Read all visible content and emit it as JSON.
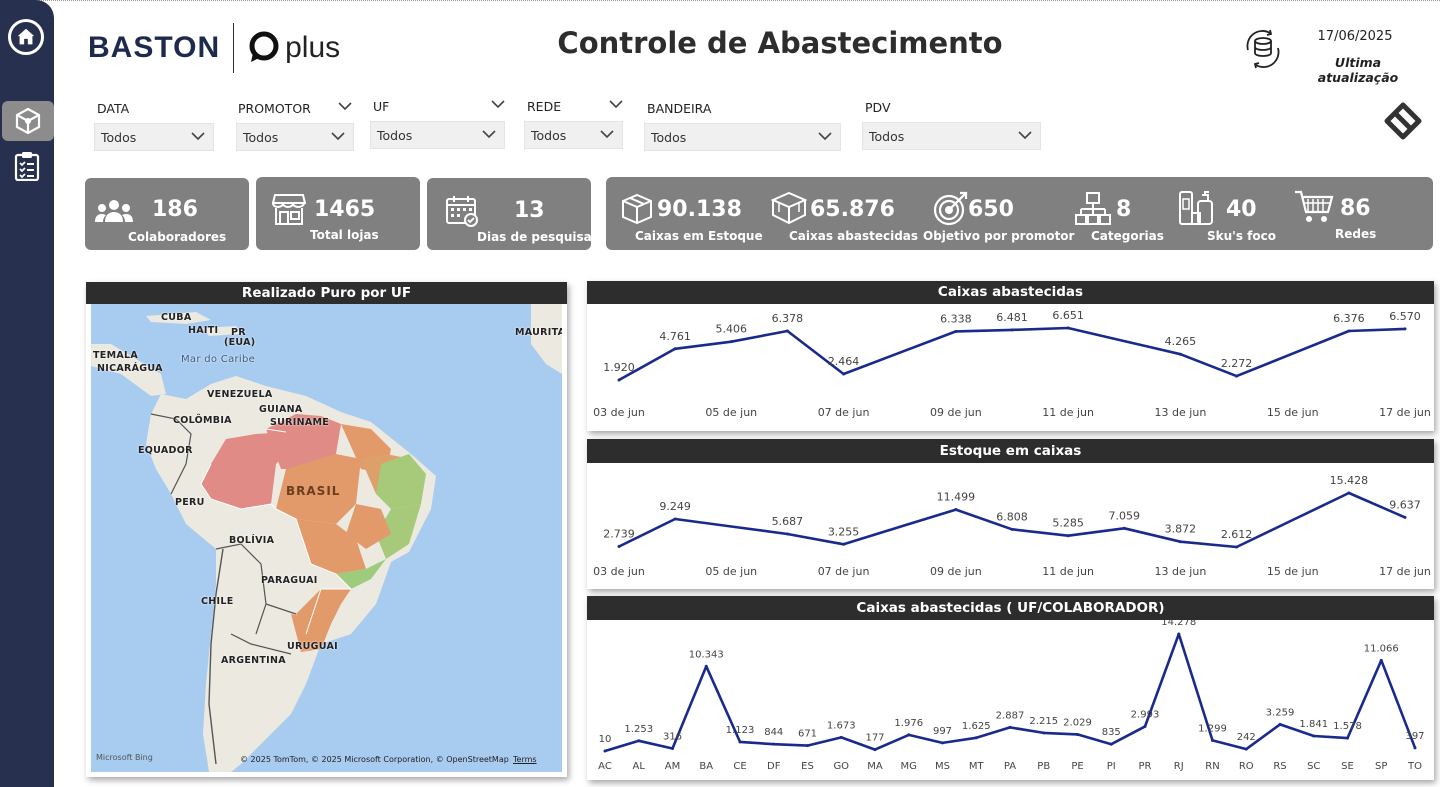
{
  "header": {
    "title": "Controle de Abastecimento",
    "logo_brand": "BASTON",
    "logo_plus": "plus",
    "update_date": "17/06/2025",
    "update_label": "Ultima atualização"
  },
  "filters": [
    {
      "label": "DATA",
      "value": "Todos"
    },
    {
      "label": "PROMOTOR",
      "value": "Todos"
    },
    {
      "label": "UF",
      "value": "Todos"
    },
    {
      "label": "REDE",
      "value": "Todos"
    },
    {
      "label": "BANDEIRA",
      "value": "Todos"
    },
    {
      "label": "PDV",
      "value": "Todos"
    }
  ],
  "kpis": [
    {
      "value": "186",
      "label": "Colaboradores",
      "icon": "people-icon"
    },
    {
      "value": "1465",
      "label": "Total lojas",
      "icon": "store-icon"
    },
    {
      "value": "13",
      "label": "Dias de pesquisa",
      "icon": "calendar-icon"
    },
    {
      "value": "90.138",
      "label": "Caixas em Estoque",
      "icon": "box-icon"
    },
    {
      "value": "65.876",
      "label": "Caixas abastecidas",
      "icon": "boxes-icon"
    },
    {
      "value": "650",
      "label": "Objetivo por promotor",
      "icon": "target-icon"
    },
    {
      "value": "8",
      "label": "Categorias",
      "icon": "hierarchy-icon"
    },
    {
      "value": "40",
      "label": "Sku's foco",
      "icon": "products-icon"
    },
    {
      "value": "86",
      "label": "Redes",
      "icon": "cart-icon"
    }
  ],
  "map": {
    "title": "Realizado Puro por UF",
    "labels": {
      "cuba": "CUBA",
      "haiti": "HAITI",
      "pr": "PR",
      "eua": "(EUA)",
      "mauritania": "MAURITA",
      "caribe": "Mar do Caribe",
      "guatemala": "TEMALA",
      "nicaragua": "NICARÁGUA",
      "venezuela": "VENEZUELA",
      "guiana": "GUIANA",
      "suriname": "SURINAME",
      "colombia": "COLÔMBIA",
      "equador": "EQUADOR",
      "brasil": "BRASIL",
      "peru": "PERU",
      "bolivia": "BOLÍVIA",
      "paraguai": "PARAGUAI",
      "chile": "CHILE",
      "uruguai": "URUGUAI",
      "argentina": "ARGENTINA"
    },
    "attribution": "© 2025 TomTom, © 2025 Microsoft Corporation, © OpenStreetMap",
    "terms": "Terms",
    "bing": "Microsoft Bing"
  },
  "chart_data": [
    {
      "type": "line",
      "title": "Caixas abastecidas",
      "x": [
        "03 de jun",
        "04 de jun",
        "05 de jun",
        "06 de jun",
        "07 de jun",
        "08 de jun",
        "09 de jun",
        "10 de jun",
        "11 de jun",
        "12 de jun",
        "13 de jun",
        "14 de jun",
        "15 de jun",
        "16 de jun",
        "17 de jun"
      ],
      "values": [
        1920,
        4761,
        5406,
        6378,
        2464,
        null,
        6338,
        6481,
        6651,
        null,
        4265,
        2272,
        null,
        6376,
        6570
      ],
      "labels": [
        "1.920",
        "4.761",
        "5.406",
        "6.378",
        "2.464",
        "",
        "6.338",
        "6.481",
        "6.651",
        "",
        "4.265",
        "2.272",
        "",
        "6.376",
        "6.570"
      ],
      "xticks": [
        "03 de jun",
        "05 de jun",
        "07 de jun",
        "09 de jun",
        "11 de jun",
        "13 de jun",
        "15 de jun",
        "17 de jun"
      ],
      "color": "#1a2a8c"
    },
    {
      "type": "line",
      "title": "Estoque em caixas",
      "x": [
        "03 de jun",
        "04 de jun",
        "05 de jun",
        "06 de jun",
        "07 de jun",
        "08 de jun",
        "09 de jun",
        "10 de jun",
        "11 de jun",
        "12 de jun",
        "13 de jun",
        "14 de jun",
        "15 de jun",
        "16 de jun",
        "17 de jun"
      ],
      "values": [
        2739,
        9249,
        null,
        5687,
        3255,
        null,
        11499,
        6808,
        5285,
        7059,
        3872,
        2612,
        null,
        15428,
        9637
      ],
      "labels": [
        "2.739",
        "9.249",
        "",
        "5.687",
        "3.255",
        "",
        "11.499",
        "6.808",
        "5.285",
        "7.059",
        "3.872",
        "2.612",
        "",
        "15.428",
        "9.637"
      ],
      "xticks": [
        "03 de jun",
        "05 de jun",
        "07 de jun",
        "09 de jun",
        "11 de jun",
        "13 de jun",
        "15 de jun",
        "17 de jun"
      ],
      "color": "#1a2a8c"
    },
    {
      "type": "line",
      "title": "Caixas abastecidas ( UF/COLABORADOR)",
      "categories": [
        "AC",
        "AL",
        "AM",
        "BA",
        "CE",
        "DF",
        "ES",
        "GO",
        "MA",
        "MG",
        "MS",
        "MT",
        "PA",
        "PB",
        "PE",
        "PI",
        "PR",
        "RJ",
        "RN",
        "RO",
        "RS",
        "SC",
        "SE",
        "SP",
        "TO"
      ],
      "values": [
        10,
        1253,
        316,
        10343,
        1123,
        844,
        671,
        1673,
        177,
        1976,
        997,
        1625,
        2887,
        2215,
        2029,
        835,
        2993,
        14278,
        1299,
        242,
        3259,
        1841,
        1578,
        11066,
        397
      ],
      "labels": [
        "10",
        "1.253",
        "316",
        "10.343",
        "1.123",
        "844",
        "671",
        "1.673",
        "177",
        "1.976",
        "997",
        "1.625",
        "2.887",
        "2.215",
        "2.029",
        "835",
        "2.993",
        "14.278",
        "1.299",
        "242",
        "3.259",
        "1.841",
        "1.578",
        "11.066",
        "397"
      ],
      "color": "#1a2a8c"
    }
  ]
}
